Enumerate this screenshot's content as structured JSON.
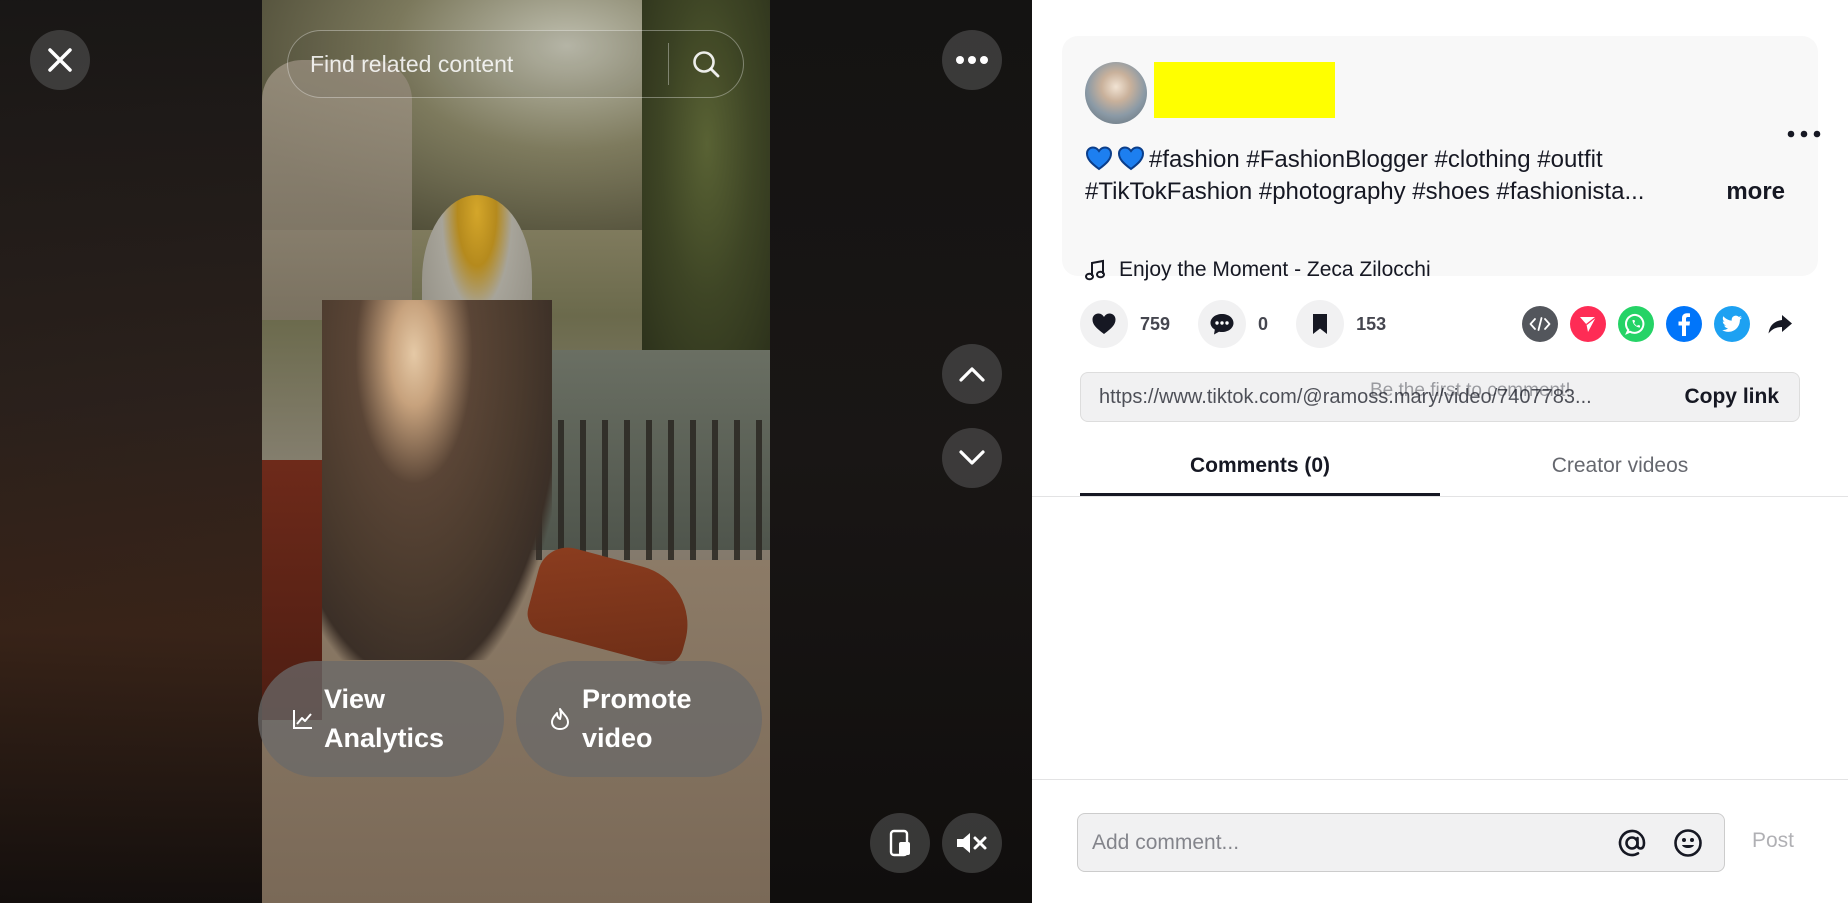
{
  "search": {
    "placeholder": "Find related content"
  },
  "video_controls": {
    "analytics_label_line1": "View",
    "analytics_label_line2": "Analytics",
    "promote_label_line1": "Promote",
    "promote_label_line2": "video"
  },
  "post": {
    "caption_line1": "#fashion #FashionBlogger #clothing #outfit",
    "caption_line2": "#TikTokFashion #photography #shoes #fashionista...",
    "more_label": "more",
    "music": "Enjoy the Moment - Zeca Zilocchi"
  },
  "stats": {
    "likes": "759",
    "comments": "0",
    "saves": "153"
  },
  "link": {
    "url": "https://www.tiktok.com/@ramoss.mary/video/7407783...",
    "copy_label": "Copy link"
  },
  "empty_comments": "Be the first to comment!",
  "tabs": [
    {
      "label": "Comments (0)",
      "active": true
    },
    {
      "label": "Creator videos",
      "active": false
    }
  ],
  "comment_box": {
    "placeholder": "Add comment...",
    "post_label": "Post"
  },
  "colors": {
    "whatsapp": "#25d366",
    "facebook": "#0075fa",
    "twitter": "#1da1f2",
    "send": "#fe2c55",
    "embed": "#53565c",
    "highlight": "#ffff00"
  }
}
